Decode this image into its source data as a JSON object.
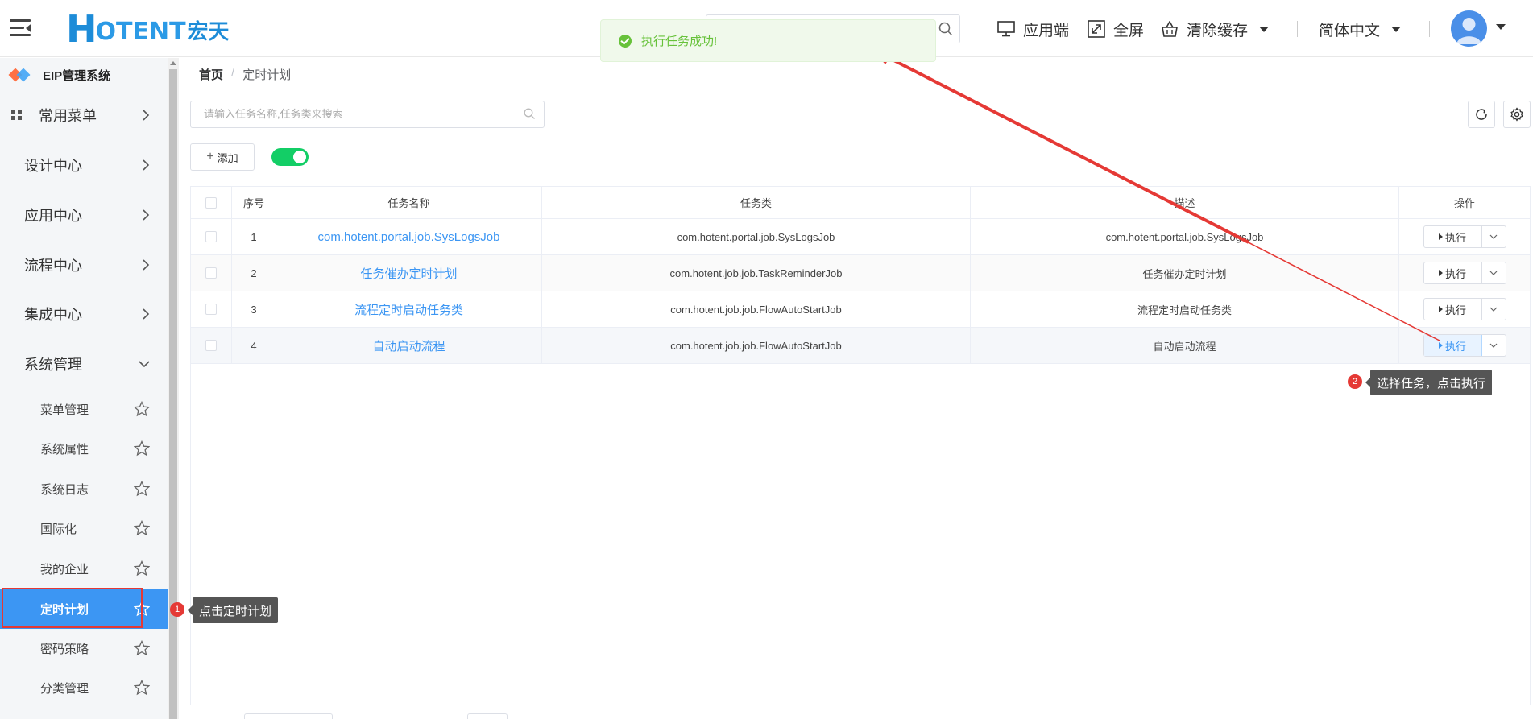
{
  "header": {
    "logo_h": "H",
    "logo_rest": "OTENT",
    "logo_cn": "宏天",
    "app_client_label": "应用端",
    "fullscreen_label": "全屏",
    "clear_cache_label": "清除缓存",
    "language_label": "简体中文"
  },
  "toast": {
    "message": "执行任务成功!"
  },
  "sidebar": {
    "system_title": "EIP管理系统",
    "common_menu": "常用菜单",
    "groups": [
      "设计中心",
      "应用中心",
      "流程中心",
      "集成中心",
      "系统管理"
    ],
    "sub_items": [
      "菜单管理",
      "系统属性",
      "系统日志",
      "国际化",
      "我的企业",
      "定时计划",
      "密码策略",
      "分类管理"
    ]
  },
  "breadcrumb": {
    "home": "首页",
    "separator": "/",
    "current": "定时计划"
  },
  "search": {
    "placeholder": "请输入任务名称,任务类来搜索"
  },
  "toolbar": {
    "add_label": "添加"
  },
  "table": {
    "headers": {
      "index": "序号",
      "name": "任务名称",
      "class": "任务类",
      "desc": "描述",
      "ops": "操作"
    },
    "rows": [
      {
        "index": "1",
        "name": "com.hotent.portal.job.SysLogsJob",
        "class": "com.hotent.portal.job.SysLogsJob",
        "desc": "com.hotent.portal.job.SysLogsJob",
        "exec": "执行"
      },
      {
        "index": "2",
        "name": "任务催办定时计划",
        "class": "com.hotent.job.job.TaskReminderJob",
        "desc": "任务催办定时计划",
        "exec": "执行"
      },
      {
        "index": "3",
        "name": "流程定时启动任务类",
        "class": "com.hotent.job.job.FlowAutoStartJob",
        "desc": "流程定时启动任务类",
        "exec": "执行"
      },
      {
        "index": "4",
        "name": "自动启动流程",
        "class": "com.hotent.job.job.FlowAutoStartJob",
        "desc": "自动启动流程",
        "exec": "执行"
      }
    ]
  },
  "annotations": {
    "step1_num": "1",
    "step1_text": "点击定时计划",
    "step2_num": "2",
    "step2_text": "选择任务，点击执行"
  },
  "colors": {
    "primary": "#3c96f3",
    "success": "#67c23a",
    "annotation_red": "#e53935",
    "toggle_on": "#13ce66"
  }
}
